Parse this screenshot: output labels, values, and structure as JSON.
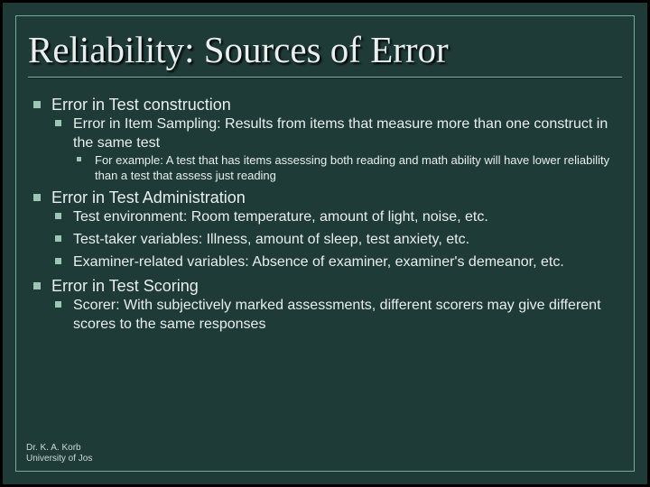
{
  "title": "Reliability: Sources of Error",
  "body": [
    {
      "text": "Error in Test construction",
      "children": [
        {
          "text": "Error in Item Sampling: Results from items that measure more than one construct in the same test",
          "children": [
            {
              "text": "For example: A test that has items assessing both reading and math ability will have lower reliability than a test that assess just reading"
            }
          ]
        }
      ]
    },
    {
      "text": "Error in Test Administration",
      "children": [
        {
          "text": "Test environment: Room temperature, amount of light, noise, etc."
        },
        {
          "text": "Test-taker variables: Illness, amount of sleep, test anxiety, etc."
        },
        {
          "text": "Examiner-related variables: Absence of examiner, examiner's demeanor, etc."
        }
      ]
    },
    {
      "text": "Error in Test Scoring",
      "children": [
        {
          "text": "Scorer: With subjectively marked assessments, different scorers may give different scores to the same responses"
        }
      ]
    }
  ],
  "footer": {
    "line1": "Dr. K. A. Korb",
    "line2": "University of Jos"
  }
}
